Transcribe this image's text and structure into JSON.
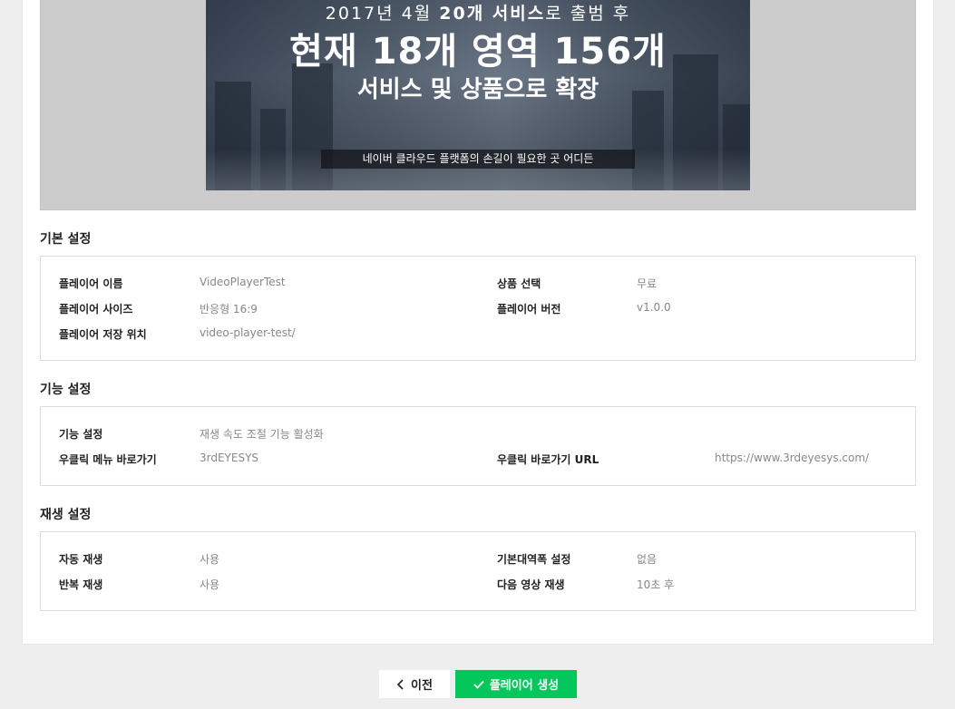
{
  "preview": {
    "line1_pre": "2017년 4월 ",
    "line1_bold": "20개 서비스",
    "line1_post": "로 출범 후",
    "line2": "현재 18개 영역 156개",
    "line3": "서비스 및 상품으로 확장",
    "caption": "네이버 클라우드 플랫폼의 손길이 필요한 곳 어디든"
  },
  "basic": {
    "title": "기본 설정",
    "player_name_label": "플레이어 이름",
    "player_name_value": "VideoPlayerTest",
    "product_label": "상품 선택",
    "product_value": "무료",
    "size_label": "플레이어 사이즈",
    "size_value": "반응형 16:9",
    "version_label": "플레이어 버전",
    "version_value": "v1.0.0",
    "location_label": "플레이어 저장 위치",
    "location_value": "video-player-test/"
  },
  "feature": {
    "title": "기능 설정",
    "feature_label": "기능 설정",
    "feature_value": "재생 속도 조절 기능 활성화",
    "rightclick_label": "우클릭 메뉴 바로가기",
    "rightclick_value": "3rdEYESYS",
    "rightclick_url_label": "우클릭 바로가기 URL",
    "rightclick_url_value": "https://www.3rdeyesys.com/"
  },
  "playback": {
    "title": "재생 설정",
    "autoplay_label": "자동 재생",
    "autoplay_value": "사용",
    "bandwidth_label": "기본대역폭 설정",
    "bandwidth_value": "없음",
    "repeat_label": "반복 재생",
    "repeat_value": "사용",
    "next_label": "다음 영상 재생",
    "next_value": "10초 후"
  },
  "footer": {
    "prev_label": "이전",
    "create_label": "플레이어 생성"
  },
  "colors": {
    "accent": "#03c75a"
  }
}
